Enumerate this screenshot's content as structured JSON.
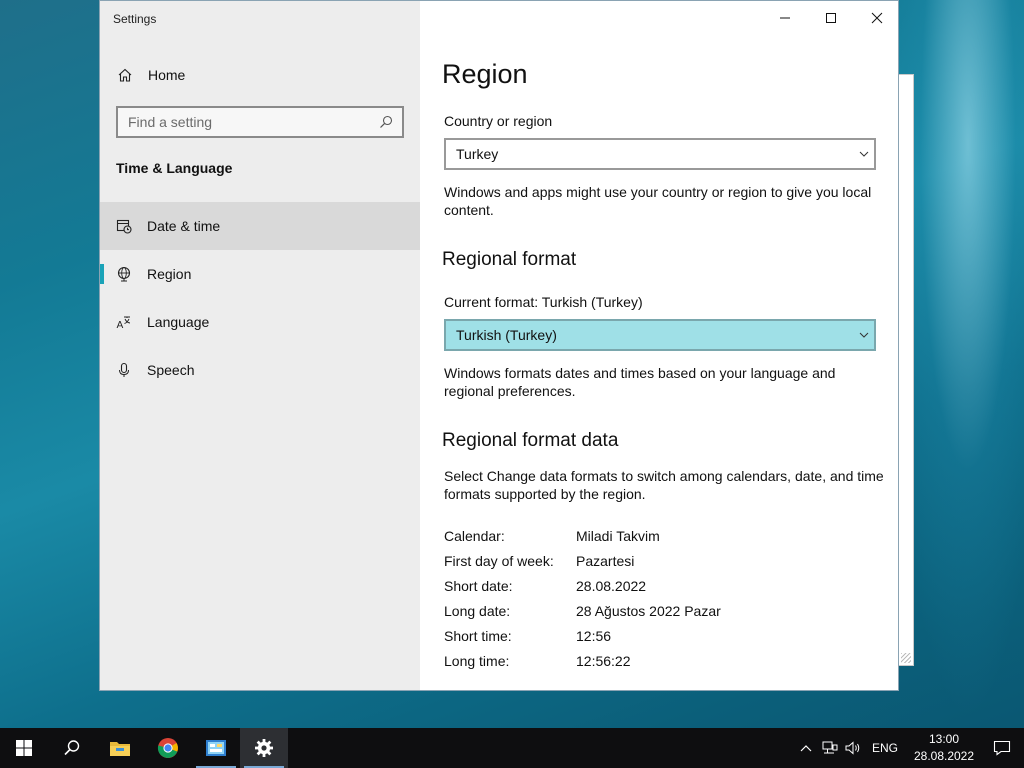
{
  "window": {
    "title": "Settings",
    "controls": {
      "minimize": "minimize",
      "maximize": "maximize",
      "close": "close"
    }
  },
  "sidebar": {
    "home_label": "Home",
    "search_placeholder": "Find a setting",
    "group_title": "Time & Language",
    "items": [
      {
        "label": "Date & time",
        "icon": "calendar-clock-icon"
      },
      {
        "label": "Region",
        "icon": "globe-icon",
        "selected": true
      },
      {
        "label": "Language",
        "icon": "language-icon"
      },
      {
        "label": "Speech",
        "icon": "microphone-icon"
      }
    ]
  },
  "main": {
    "title": "Region",
    "country": {
      "label": "Country or region",
      "value": "Turkey",
      "description": "Windows and apps might use your country or region to give you local content."
    },
    "format": {
      "section_title": "Regional format",
      "label": "Current format: Turkish (Turkey)",
      "value": "Turkish (Turkey)",
      "description": "Windows formats dates and times based on your language and regional preferences."
    },
    "format_data": {
      "section_title": "Regional format data",
      "description": "Select Change data formats to switch among calendars, date, and time formats supported by the region.",
      "rows": [
        {
          "key": "Calendar:",
          "value": "Miladi Takvim"
        },
        {
          "key": "First day of week:",
          "value": "Pazartesi"
        },
        {
          "key": "Short date:",
          "value": "28.08.2022"
        },
        {
          "key": "Long date:",
          "value": "28 Ağustos 2022 Pazar"
        },
        {
          "key": "Short time:",
          "value": "12:56"
        },
        {
          "key": "Long time:",
          "value": "12:56:22"
        }
      ]
    }
  },
  "taskbar": {
    "apps": [
      "start-icon",
      "search-icon",
      "file-explorer-icon",
      "chrome-icon",
      "control-panel-icon",
      "settings-gear-icon"
    ],
    "language": "ENG",
    "time": "13:00",
    "date": "28.08.2022"
  },
  "colors": {
    "accent": "#1aa3b8",
    "selected_dropdown": "#9fe0e7",
    "sidebar_bg": "#ededed",
    "taskbar_bg": "#0e0e10"
  }
}
